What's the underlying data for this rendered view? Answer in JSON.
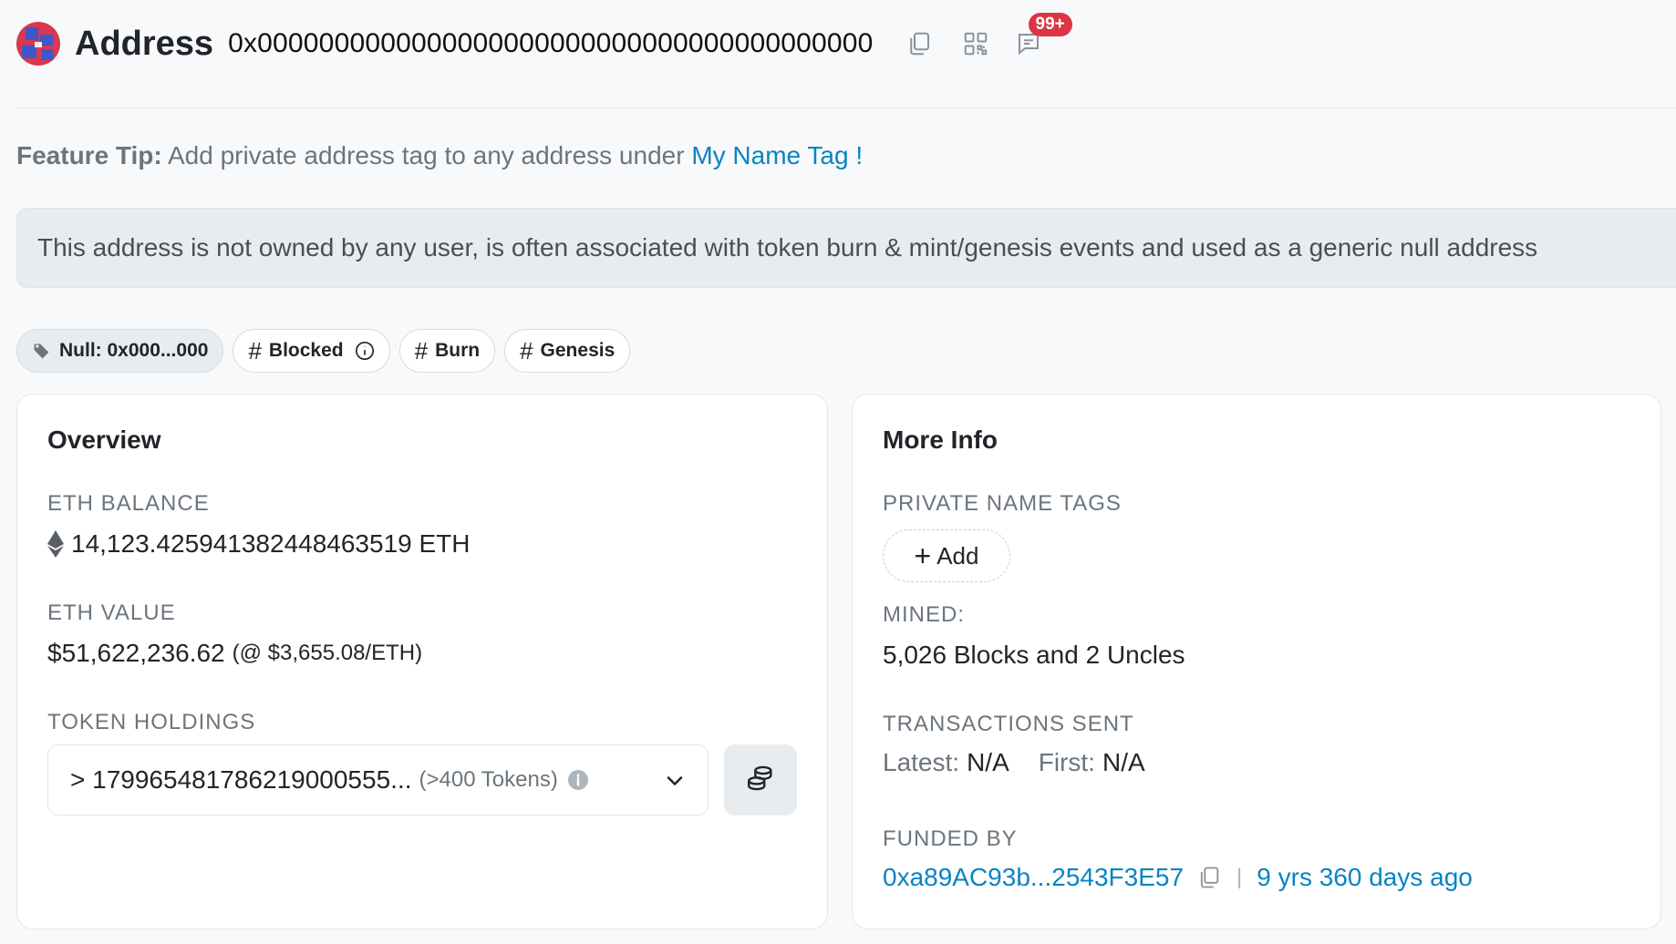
{
  "header": {
    "title": "Address",
    "address": "0x0000000000000000000000000000000000000000",
    "notifications_badge": "99+"
  },
  "feature_tip": {
    "label": "Feature Tip:",
    "text": " Add private address tag to any address under ",
    "link": "My Name Tag !"
  },
  "notice": "This address is not owned by any user, is often associated with token burn & mint/genesis events and used as a generic null address",
  "tags": [
    {
      "label": "Null: 0x000...000",
      "icon": "tag-icon"
    },
    {
      "label": "Blocked",
      "icon": "hash-icon"
    },
    {
      "label": "Burn",
      "icon": "hash-icon"
    },
    {
      "label": "Genesis",
      "icon": "hash-icon"
    }
  ],
  "overview": {
    "title": "Overview",
    "eth_balance_label": "ETH BALANCE",
    "eth_balance": "14,123.425941382448463519 ETH",
    "eth_value_label": "ETH VALUE",
    "eth_value": "$51,622,236.62",
    "eth_price": "(@ $3,655.08/ETH)",
    "token_holdings_label": "TOKEN HOLDINGS",
    "token_holdings_value": "> 1799654817862190005​55...",
    "token_count": "(>400 Tokens)"
  },
  "more_info": {
    "title": "More Info",
    "private_name_tags_label": "PRIVATE NAME TAGS",
    "add_label": "Add",
    "mined_label": "MINED:",
    "mined_value": "5,026 Blocks and 2 Uncles",
    "transactions_sent_label": "TRANSACTIONS SENT",
    "latest_label": "Latest:",
    "latest_value": "N/A",
    "first_label": "First:",
    "first_value": "N/A",
    "funded_by_label": "FUNDED BY",
    "funded_by_address": "0xa89AC93b...2543F3E57",
    "funded_age": "9 yrs 360 days ago"
  },
  "colors": {
    "link": "#0784c3",
    "badge": "#dc3545",
    "background": "#f8f9fb"
  }
}
